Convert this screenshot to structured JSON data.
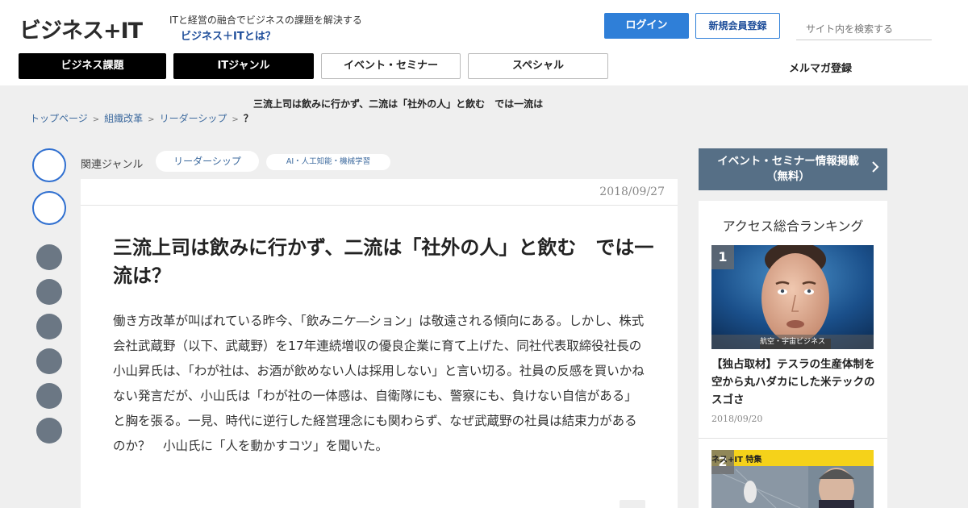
{
  "header": {
    "logo": "ビジネス+IT",
    "tagline": "ITと経営の融合でビジネスの課題を解決する",
    "about_link": "ビジネス＋ITとは？",
    "login_button": "ログイン",
    "register_button": "新規会員登録",
    "search_placeholder": "サイト内を検索する"
  },
  "nav": {
    "tabs": [
      "ビジネス課題",
      "ITジャンル",
      "イベント・セミナー",
      "スペシャル"
    ],
    "newsletter": "メルマガ登録"
  },
  "breadcrumb": {
    "headline": "三流上司は飲みに行かず、二流は「社外の人」と飲む　では一流は",
    "items": [
      "トップページ",
      "組織改革",
      "リーダーシップ"
    ],
    "current": "？"
  },
  "article": {
    "genre_label": "関連ジャンル",
    "genres": [
      "リーダーシップ",
      "AI・人工知能・機械学習"
    ],
    "date": "2018/09/27",
    "title": "三流上司は飲みに行かず、二流は「社外の人」と飲む　では一流は？",
    "lead": "働き方改革が叫ばれている昨今、「飲みニケ―ション」は敬遠される傾向にある。しかし、株式会社武蔵野（以下、武蔵野）を17年連続増収の優良企業に育て上げた、同社代表取締役社長の小山昇氏は、「わが社は、お酒が飲めない人は採用しない」と言い切る。社員の反感を買いかねない発言だが、小山氏は「わが社の一体感は、自衛隊にも、警察にも、負けない自信がある」と胸を張る。一見、時代に逆行した経営理念にも関わらず、なぜ武蔵野の社員は結束力があるのか？　小山氏に「人を動かすコツ」を聞いた。"
  },
  "sidebar": {
    "event_banner_line1": "イベント・セミナー情報掲載",
    "event_banner_line2": "（無料）",
    "ranking_title": "アクセス総合ランキング",
    "ranking": [
      {
        "rank": "1",
        "category": "航空・宇宙ビジネス",
        "headline": "【独占取材】テスラの生産体制を空から丸ハダカにした米テックのスゴさ",
        "date": "2018/09/20"
      },
      {
        "rank": "2",
        "banner": "ネス+IT 特集"
      }
    ]
  },
  "colors": {
    "accent_blue": "#2f7fd8",
    "link_blue": "#3d6a9e",
    "banner_slate": "#566f86",
    "share_gray": "#6b7784"
  }
}
